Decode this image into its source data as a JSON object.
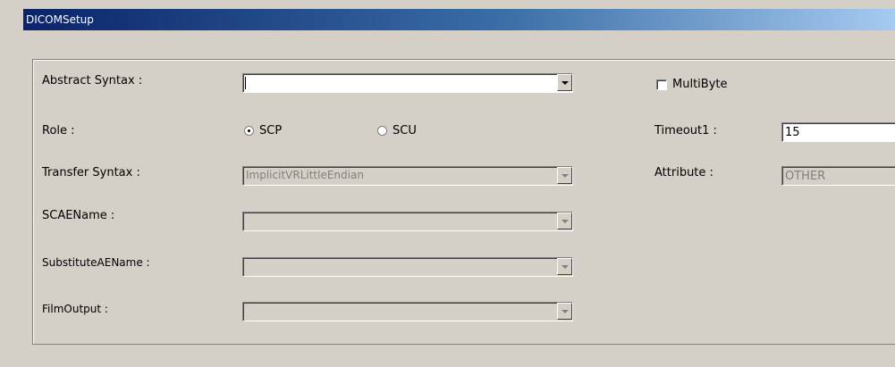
{
  "window": {
    "title": "DICOMSetup"
  },
  "form": {
    "abstract_syntax": {
      "label": "Abstract Syntax :",
      "value": ""
    },
    "multibyte": {
      "label": "MultiByte",
      "checked": false
    },
    "role": {
      "label": "Role :",
      "options": [
        "SCP",
        "SCU"
      ],
      "selected": "SCP"
    },
    "timeout1": {
      "label": "Timeout1 :",
      "value": "15"
    },
    "transfer_syntax": {
      "label": "Transfer Syntax :",
      "value": "ImplicitVRLittleEndian"
    },
    "attribute": {
      "label": "Attribute :",
      "value": "OTHER"
    },
    "sc_aename": {
      "label": "SCAEName :",
      "value": ""
    },
    "substitute_aename": {
      "label": "SubstituteAEName :",
      "value": ""
    },
    "film_output": {
      "label": "FilmOutput :",
      "value": ""
    }
  }
}
